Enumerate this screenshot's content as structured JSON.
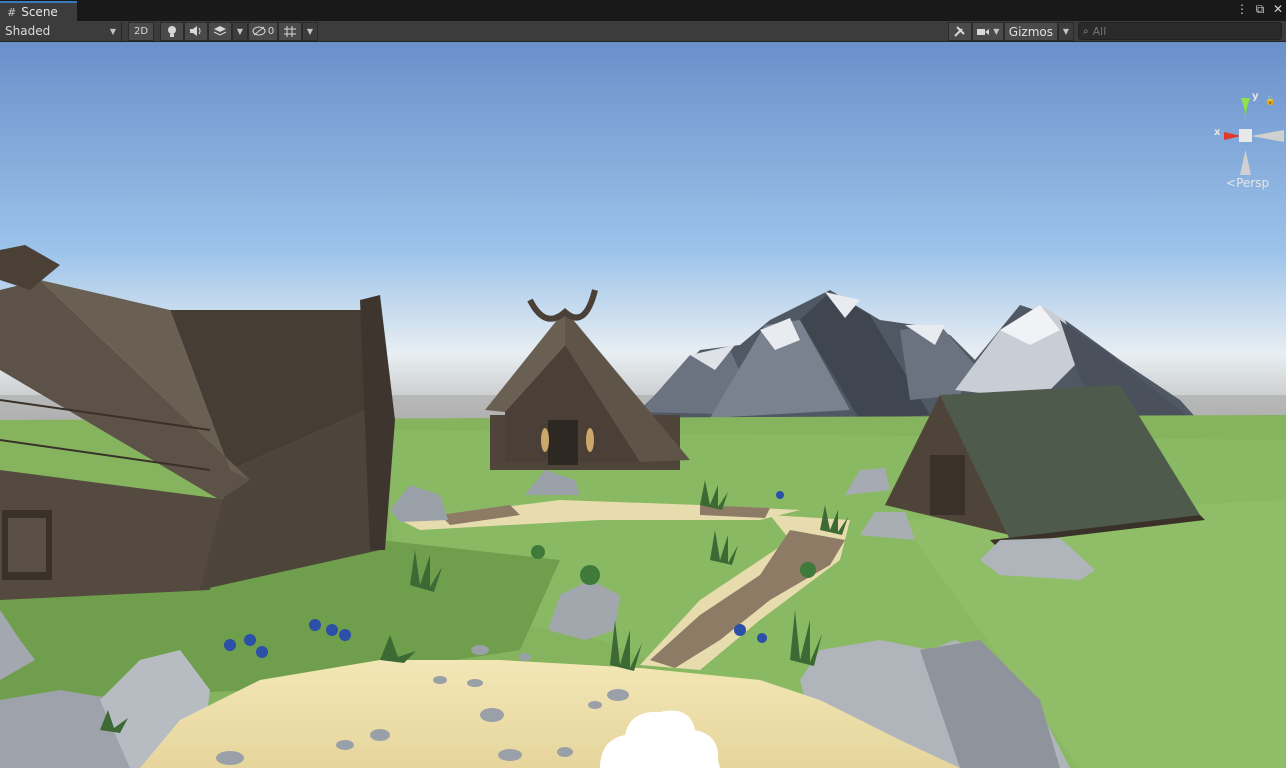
{
  "tab": {
    "icon": "grid-icon",
    "title": "Scene"
  },
  "window_controls": [
    "⋮",
    "⧉",
    "✕"
  ],
  "toolbar": {
    "draw_mode": "Shaded",
    "mode_2d": "2D",
    "hidden_count": "0",
    "gizmos_label": "Gizmos"
  },
  "search": {
    "placeholder": "All"
  },
  "orientation_gizmo": {
    "x_label": "x",
    "y_label": "y",
    "projection": "Persp"
  },
  "colors": {
    "accent": "#3a79bb",
    "toolbar_bg": "#3c3c3c",
    "tabbar_bg": "#191919",
    "x_axis": "#e03a2a",
    "y_axis": "#7ad33a"
  }
}
